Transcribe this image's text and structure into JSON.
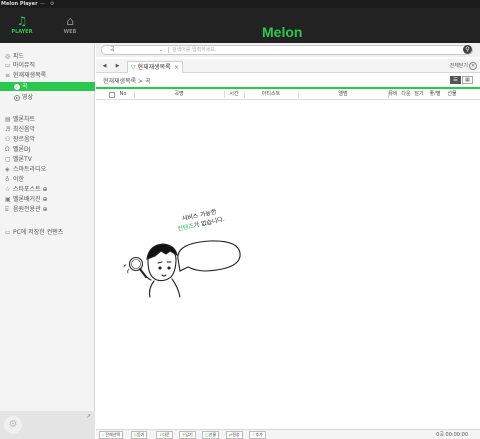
{
  "window": {
    "title": "Melon Player"
  },
  "topnav": {
    "player_label": "PLAYER",
    "web_label": "WEB",
    "logo": "Melon"
  },
  "sidebar": {
    "items": [
      {
        "label": "피드",
        "icon": "feed-icon"
      },
      {
        "label": "마이뮤직",
        "icon": "my-music-icon"
      },
      {
        "label": "현재재생목록",
        "icon": "playlist-icon"
      },
      {
        "label": "곡",
        "icon": "music-circle-icon"
      },
      {
        "label": "영상",
        "icon": "video-circle-icon"
      },
      {
        "label": "멜론차트",
        "icon": "chart-icon"
      },
      {
        "label": "최신음악",
        "icon": "new-music-icon"
      },
      {
        "label": "장르음악",
        "icon": "genre-icon"
      },
      {
        "label": "멜론DJ",
        "icon": "headphone-icon"
      },
      {
        "label": "멜론TV",
        "icon": "tv-icon"
      },
      {
        "label": "스마트라디오",
        "icon": "radio-icon"
      },
      {
        "label": "이한",
        "icon": "bulb-icon"
      },
      {
        "label": "스타포스트 ⊕",
        "icon": "star-post-icon"
      },
      {
        "label": "멜론배거진 ⊕",
        "icon": "magazine-icon"
      },
      {
        "label": "음원전용관 ⊕",
        "icon": "store-icon"
      },
      {
        "label": "PC에 저장한 컨텐츠",
        "icon": "pc-icon"
      }
    ],
    "expand_icon": "expand-arrow-icon"
  },
  "search": {
    "category": "곡",
    "placeholder": "검색어를 입력하세요."
  },
  "tabs": [
    {
      "label": "현재재생목록"
    }
  ],
  "tabbar": {
    "close_all": "전체닫기"
  },
  "breadcrumb": "현재재생목록 > 곡",
  "table": {
    "columns": [
      "No",
      "곡명",
      "시간",
      "아티스트",
      "앨범",
      "뮤비",
      "다운",
      "담기",
      "좋/별",
      "선물"
    ]
  },
  "empty_message": {
    "line1": "서비스 가능한",
    "line2_highlight": "컨텐츠",
    "line2_rest": "가 없습니다."
  },
  "bottom_buttons": [
    "전체선택",
    "듣기",
    "다운",
    "담기",
    "선물",
    "전송",
    "추가"
  ],
  "bottom_info": "0곡 00:00:00",
  "colors": {
    "accent": "#2ac84f",
    "topbar": "#222222"
  }
}
